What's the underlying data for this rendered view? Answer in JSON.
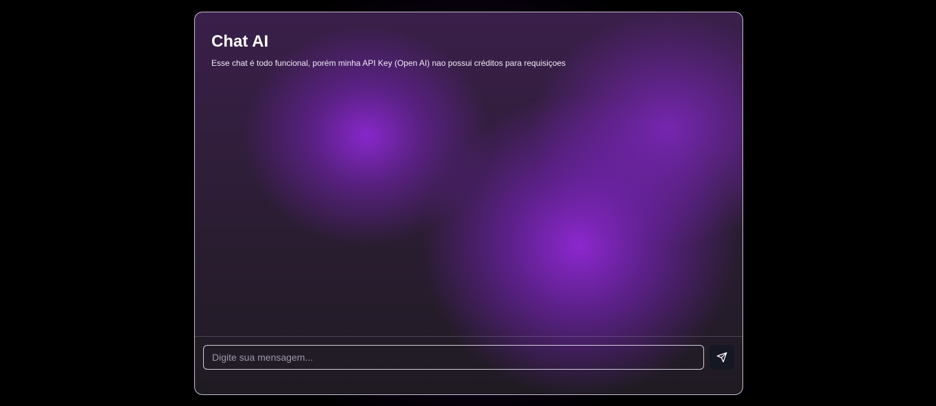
{
  "chat": {
    "title": "Chat AI",
    "subtitle": "Esse chat é todo funcional, porém minha API Key (Open AI) nao possui créditos para requisiçoes",
    "messages": []
  },
  "input": {
    "placeholder": "Digite sua mensagem...",
    "value": ""
  },
  "send_button": {
    "icon": "send-icon"
  },
  "colors": {
    "background": "#000000",
    "accent_purple": "#8a2be2",
    "card_border": "#e6dcf5",
    "send_button_bg": "#151722"
  }
}
